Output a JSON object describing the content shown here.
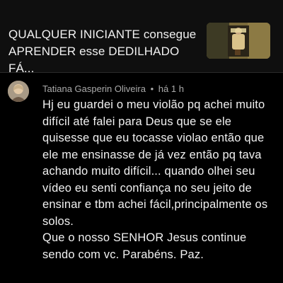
{
  "video": {
    "title": "QUALQUER INICIANTE consegue\nAPRENDER  esse DEDILHADO FÁ..."
  },
  "comment": {
    "author": "Tatiana Gasperin Oliveira",
    "separator": "•",
    "time": "há 1 h",
    "lines": [
      "Hj eu guardei o meu violão pq achei muito",
      "difícil até falei para Deus que se ele",
      "quisesse que eu tocasse violao então que",
      "ele me ensinasse de já vez então pq tava",
      "achando muito difícil... quando olhei seu",
      "vídeo eu senti confiança no seu jeito de",
      "ensinar e tbm achei fácil,principalmente os",
      "solos.",
      "Que o  nosso SENHOR Jesus continue",
      "sendo com vc. Parabéns.  Paz."
    ]
  },
  "colors": {
    "background": "#000000",
    "header_background": "#0f0f0f",
    "primary_text": "#f1f1f1",
    "secondary_text": "#aaaaaa"
  },
  "icons": {
    "thumbnail": "video-thumbnail",
    "avatar": "user-avatar"
  }
}
